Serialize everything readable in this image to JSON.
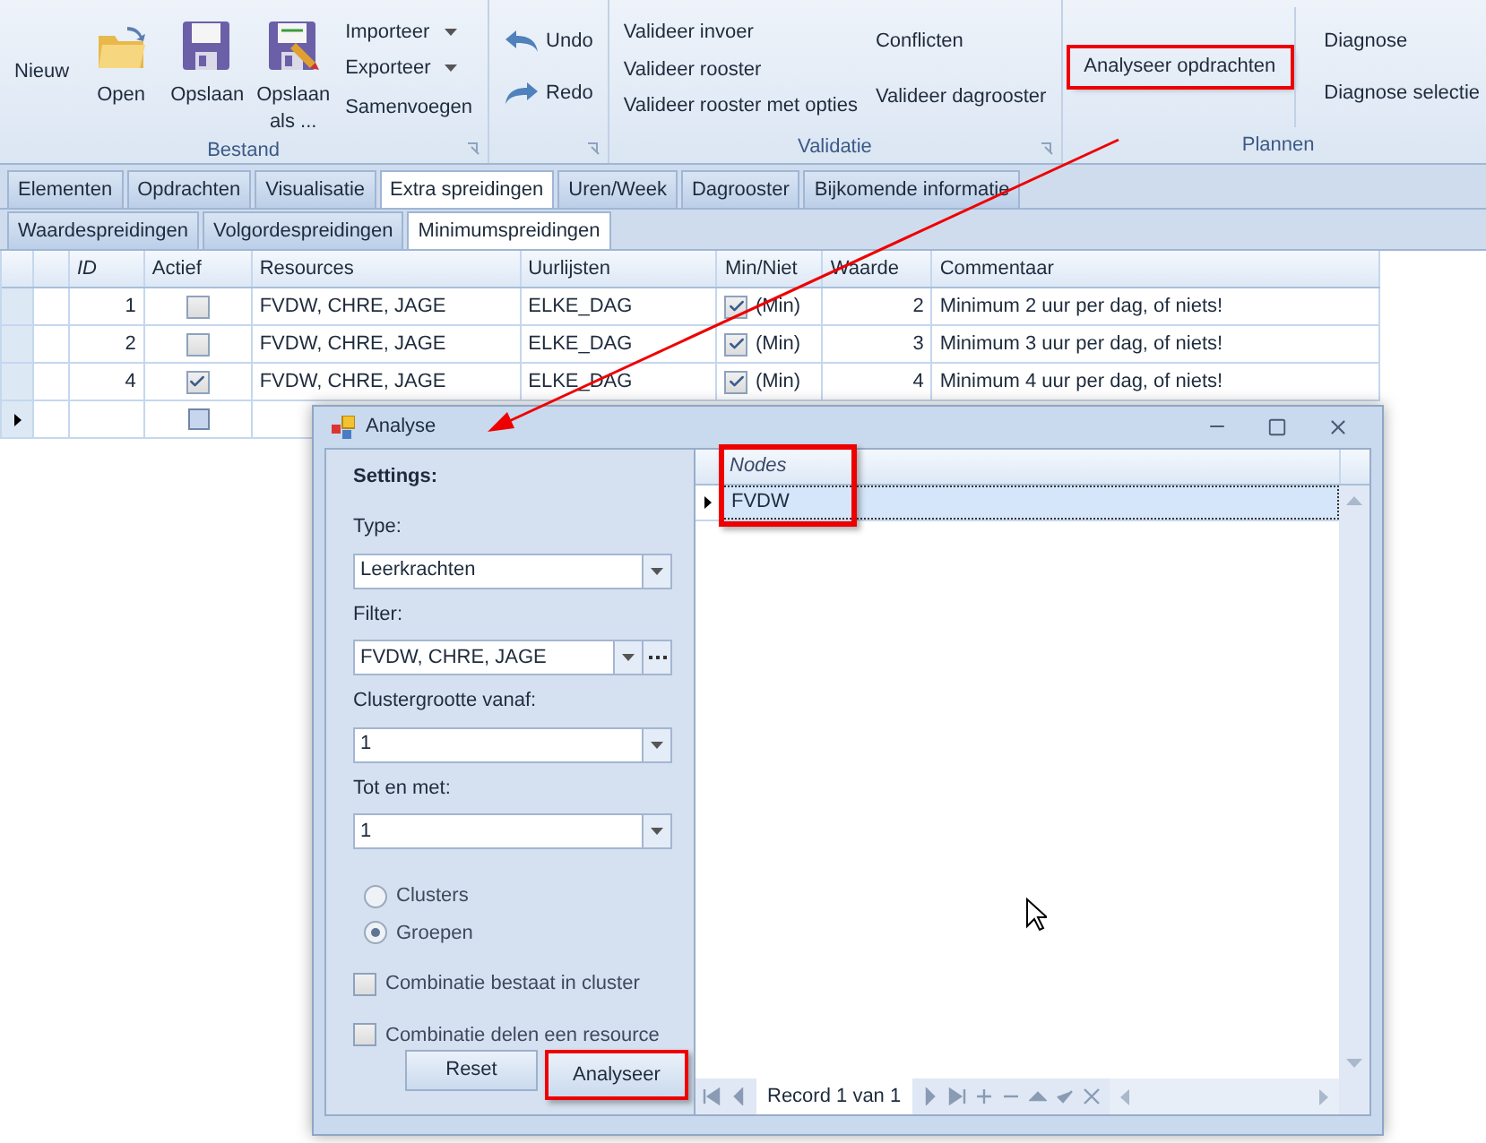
{
  "ribbon": {
    "groups": [
      {
        "label": "Bestand",
        "launcher": true,
        "columns": [
          [
            {
              "kind": "plain-large",
              "label": "Nieuw",
              "highlighted": false
            }
          ],
          [
            {
              "kind": "large",
              "label": "Open",
              "highlighted": false
            }
          ],
          [
            {
              "kind": "large",
              "label": "Opslaan",
              "highlighted": false
            }
          ],
          [
            {
              "kind": "large",
              "label": "Opslaan als ...",
              "highlighted": false
            }
          ],
          [
            {
              "kind": "menu",
              "label": "Importeer",
              "highlighted": false
            },
            {
              "kind": "menu",
              "label": "Exporteer",
              "highlighted": false
            },
            {
              "kind": "small",
              "label": "Samenvoegen",
              "highlighted": false
            }
          ]
        ]
      },
      {
        "launcher": true,
        "columns": [
          [
            {
              "kind": "icon-small",
              "label": "Undo",
              "highlighted": false
            },
            {
              "kind": "icon-small",
              "label": "Redo",
              "highlighted": false
            }
          ]
        ]
      },
      {
        "label": "Validatie",
        "launcher": true,
        "columns": [
          [
            {
              "kind": "small",
              "label": "Valideer invoer",
              "highlighted": false
            },
            {
              "kind": "small",
              "label": "Valideer rooster",
              "highlighted": false
            },
            {
              "kind": "small",
              "label": "Valideer rooster met opties",
              "highlighted": false
            }
          ],
          [
            {
              "kind": "small",
              "label": "Conflicten",
              "highlighted": false
            },
            {
              "kind": "small",
              "label": "Valideer dagrooster",
              "highlighted": false
            }
          ]
        ]
      },
      {
        "label": "Plannen",
        "columns": [
          [
            {
              "kind": "small",
              "label": "Analyseer opdrachten",
              "highlighted": true
            }
          ],
          [
            {
              "kind": "small",
              "label": "Diagnose",
              "highlighted": false
            },
            {
              "kind": "small",
              "label": "Diagnose selectie",
              "highlighted": false
            }
          ]
        ]
      }
    ]
  },
  "tabs": [
    {
      "label": "Elementen",
      "selected": false
    },
    {
      "label": "Opdrachten",
      "selected": false
    },
    {
      "label": "Visualisatie",
      "selected": false
    },
    {
      "label": "Extra spreidingen",
      "selected": true
    },
    {
      "label": "Uren/Week",
      "selected": false
    },
    {
      "label": "Dagrooster",
      "selected": false
    },
    {
      "label": "Bijkomende informatie",
      "selected": false
    }
  ],
  "subtabs": [
    {
      "label": "Waardespreidingen",
      "selected": false
    },
    {
      "label": "Volgordespreidingen",
      "selected": false
    },
    {
      "label": "Minimumspreidingen",
      "selected": true
    }
  ],
  "table": {
    "columns": [
      "ID",
      "Actief",
      "Resources",
      "Uurlijsten",
      "Min/Niet",
      "Waarde",
      "Commentaar"
    ],
    "rows": [
      {
        "kind": "data",
        "id": "1",
        "actief": false,
        "resources": "FVDW, CHRE, JAGE",
        "uurlijsten": "ELKE_DAG",
        "min_niet": true,
        "min_label": "(Min)",
        "waarde": "2",
        "commentaar": "Minimum 2 uur per dag, of niets!"
      },
      {
        "kind": "data",
        "id": "2",
        "actief": false,
        "resources": "FVDW, CHRE, JAGE",
        "uurlijsten": "ELKE_DAG",
        "min_niet": true,
        "min_label": "(Min)",
        "waarde": "3",
        "commentaar": "Minimum 3 uur per dag, of niets!"
      },
      {
        "kind": "data",
        "id": "4",
        "actief": true,
        "resources": "FVDW, CHRE, JAGE",
        "uurlijsten": "ELKE_DAG",
        "min_niet": true,
        "min_label": "(Min)",
        "waarde": "4",
        "commentaar": "Minimum 4 uur per dag, of niets!"
      },
      {
        "kind": "new",
        "actief": false
      }
    ]
  },
  "dialog": {
    "title": "Analyse",
    "settings_heading": "Settings:",
    "fields": [
      {
        "label": "Type:",
        "value": "Leerkrachten",
        "ellipsis": false
      },
      {
        "label": "Filter:",
        "value": "FVDW, CHRE, JAGE",
        "ellipsis": true
      },
      {
        "label": "Clustergrootte vanaf:",
        "value": "1",
        "ellipsis": false
      },
      {
        "label": "Tot en met:",
        "value": "1",
        "ellipsis": false
      }
    ],
    "radios": [
      {
        "label": "Clusters",
        "selected": false
      },
      {
        "label": "Groepen",
        "selected": true
      }
    ],
    "checkboxes": [
      {
        "label": "Combinatie bestaat in cluster",
        "checked": false
      },
      {
        "label": "Combinatie delen een resource",
        "checked": false
      }
    ],
    "buttons": [
      {
        "label": "Reset",
        "highlighted": false
      },
      {
        "label": "Analyseer",
        "highlighted": true
      }
    ],
    "grid": {
      "column": "Nodes",
      "highlighted": true,
      "rows": [
        {
          "value": "FVDW",
          "selected": true
        }
      ],
      "navigator": "Record 1 van 1"
    }
  }
}
